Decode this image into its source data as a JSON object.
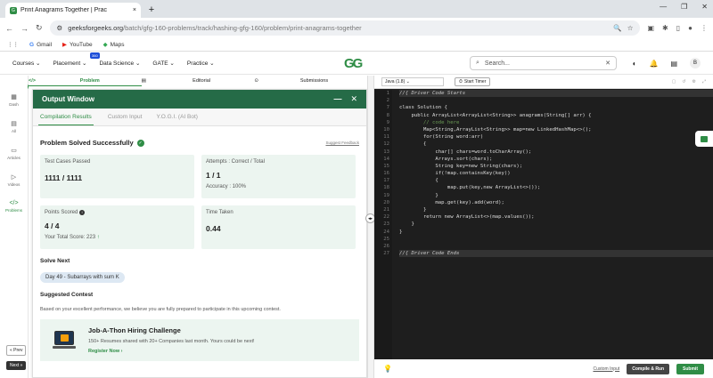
{
  "browser": {
    "tab_title": "Print Anagrams Together | Prac",
    "tab_close": "×",
    "new_tab": "+",
    "url_domain": "geeksforgeeks.org",
    "url_path": "/batch/gfg-160-problems/track/hashing-gfg-160/problem/print-anagrams-together",
    "bookmarks": [
      "Gmail",
      "YouTube",
      "Maps"
    ]
  },
  "nav": {
    "menu": [
      "Courses",
      "Placement",
      "Data Science",
      "GATE",
      "Practice"
    ],
    "badge": "360",
    "logo": "GG",
    "search_placeholder": "Search...",
    "avatar_letter": "B"
  },
  "rail": {
    "items": [
      "Dash",
      "All",
      "Articles",
      "Videos",
      "Problems"
    ],
    "prev": "« Prev",
    "next": "Next »"
  },
  "problem_tabs": [
    "Problem",
    "Editorial",
    "Submissions"
  ],
  "output": {
    "title": "Output Window",
    "tabs": [
      "Compilation Results",
      "Custom Input",
      "Y.O.G.I. (AI Bot)"
    ],
    "status": "Problem Solved Successfully",
    "feedback": "Suggest Feedback",
    "cards": {
      "tests_label": "Test Cases Passed",
      "tests_value": "1111 / 1111",
      "attempts_label": "Attempts : Correct / Total",
      "attempts_value": "1 / 1",
      "accuracy": "Accuracy : 100%",
      "points_label": "Points Scored",
      "points_value": "4 / 4",
      "total_score": "Your Total Score: 223",
      "time_label": "Time Taken",
      "time_value": "0.44"
    },
    "solve_next_title": "Solve Next",
    "solve_next_chip": "Day 49 - Subarrays with sum K",
    "suggested_title": "Suggested Contest",
    "suggested_desc": "Based on your excellent performance, we believe you are fully prepared to participate in this upcoming contest.",
    "contest_title": "Job-A-Thon Hiring Challenge",
    "contest_desc": "150+ Resumes shared with 20+ Companies last month. Yours could be next!",
    "register": "Register Now"
  },
  "editor": {
    "language": "Java (1.8)",
    "timer": "Start Timer",
    "line_numbers": [
      "1",
      "2",
      "7",
      "8",
      "9",
      "10",
      "11",
      "12",
      "13",
      "14",
      "15",
      "16",
      "17",
      "18",
      "19",
      "20",
      "21",
      "22",
      "23",
      "24",
      "25",
      "26",
      "27"
    ],
    "lines": [
      "//{ Driver Code Starts",
      "",
      "class Solution {",
      "    public ArrayList<ArrayList<String>> anagrams(String[] arr) {",
      "        // code here",
      "        Map<String,ArrayList<String>> map=new LinkedHashMap<>();",
      "        for(String word:arr)",
      "        {",
      "            char[] chars=word.toCharArray();",
      "            Arrays.sort(chars);",
      "            String key=new String(chars);",
      "            if(!map.containsKey(key))",
      "            {",
      "                map.put(key,new ArrayList<>());",
      "            }",
      "            map.get(key).add(word);",
      "        }",
      "        return new ArrayList<>(map.values());",
      "    }",
      "}",
      "",
      "",
      "//{ Driver Code Ends"
    ],
    "custom_input": "Custom Input",
    "compile": "Compile & Run",
    "submit": "Submit"
  },
  "colors": {
    "accent": "#2f8d46",
    "header_green": "#256b47",
    "editor_bg": "#1e1e1e"
  }
}
